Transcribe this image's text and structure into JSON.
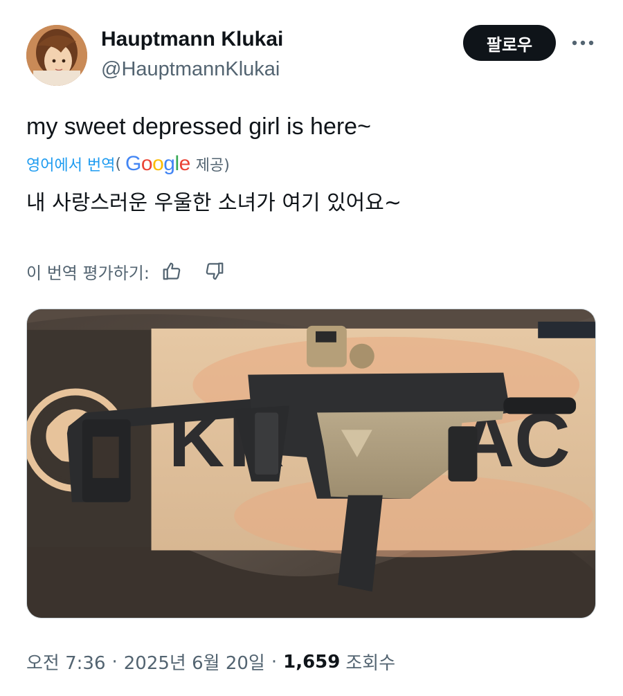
{
  "tweet": {
    "author": {
      "display_name": "Hauptmann Klukai",
      "handle": "@HauptmannKlukai"
    },
    "follow_label": "팔로우",
    "text": "my sweet depressed girl is here~",
    "translation": {
      "translated_from": "영어에서 번역",
      "paren_open": "(",
      "provider_suffix": "제공)",
      "text": "내 사랑스러운 우울한 소녀가 여기 있어요~"
    },
    "rate_label": "이 번역 평가하기:",
    "image_text": {
      "box_brand": "KRISS VECTOR",
      "box_brand_visible": "KR   AC"
    },
    "meta": {
      "time": "오전 7:36",
      "separator": "·",
      "date": "2025년 6월 20일",
      "views": "1,659",
      "views_label": "조회수"
    }
  },
  "colors": {
    "text_primary": "#0f1419",
    "text_secondary": "#536471",
    "link_blue": "#1d9bf0",
    "follow_bg": "#0f1419"
  },
  "icons": [
    "avatar",
    "more-icon",
    "google-logo",
    "thumbs-up-icon",
    "thumbs-down-icon"
  ]
}
